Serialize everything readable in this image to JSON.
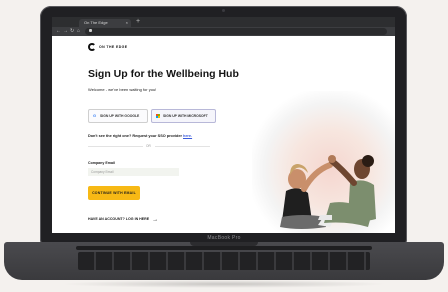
{
  "browser": {
    "tab_title": "On The Edge",
    "tab_close": "×",
    "new_tab": "+"
  },
  "brand": {
    "name": "ON THE EDGE"
  },
  "page": {
    "title": "Sign Up for the Wellbeing Hub",
    "subtitle": "Welcome - we've been waiting for you!",
    "google_button": "SIGN UP WITH GOOGLE",
    "microsoft_button": "SIGN UP WITH MICROSOFT",
    "sso_question": "Don't see the right one? Request your SSO provider ",
    "sso_link": "here.",
    "divider_text": "OR",
    "email_label": "Company Email",
    "email_placeholder": "Company Email",
    "email_value": "",
    "continue_button": "CONTINUE WITH EMAIL",
    "login_text": "HAVE AN ACCOUNT? LOG IN HERE",
    "login_arrow": "→"
  },
  "device": {
    "model": "MacBook Pro"
  },
  "colors": {
    "accent": "#f7b915",
    "link": "#3b5bdb",
    "browser_chrome": "#2d2e30"
  },
  "icons": {
    "google": "google-icon",
    "microsoft": "microsoft-icon",
    "back": "back-arrow-icon",
    "forward": "forward-arrow-icon",
    "reload": "reload-icon",
    "home": "home-icon",
    "lock": "lock-icon"
  }
}
